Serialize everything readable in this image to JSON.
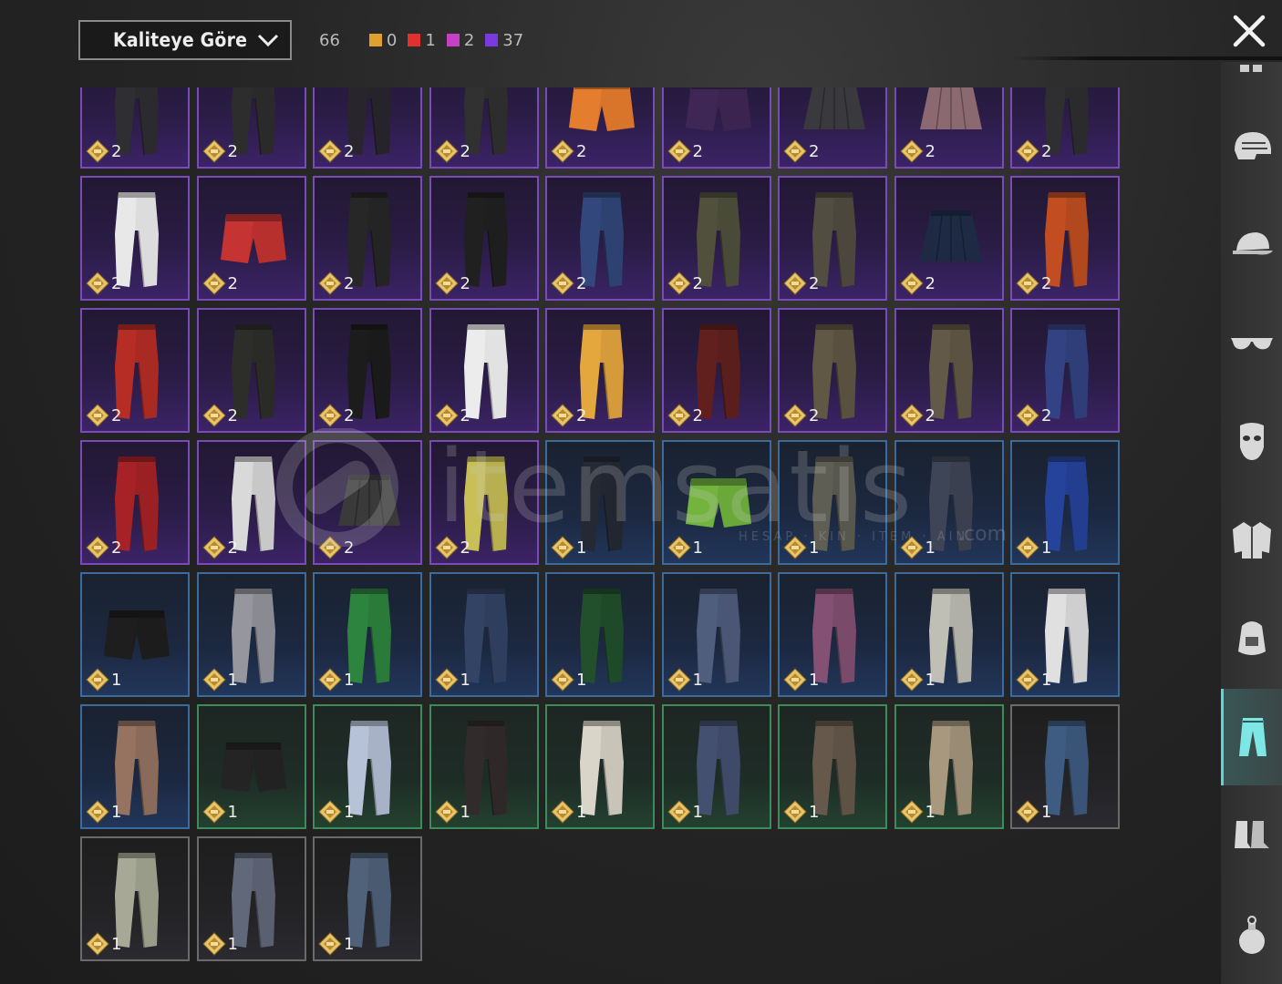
{
  "toolbar": {
    "sort_label": "Kaliteye Göre",
    "total_count": "66",
    "quality_counts": [
      {
        "color": "#e0a030",
        "value": "0"
      },
      {
        "color": "#e03030",
        "value": "1"
      },
      {
        "color": "#c640c6",
        "value": "2"
      },
      {
        "color": "#7a3ae0",
        "value": "37"
      }
    ]
  },
  "watermark": {
    "text": "itemsatis",
    "sub": "HESAP · KIN · ITEM · AIN",
    "com": ".com"
  },
  "items": [
    {
      "rarity": "purple",
      "qty": "2",
      "kind": "pants",
      "color": "#2b2b2f"
    },
    {
      "rarity": "purple",
      "qty": "2",
      "kind": "pants",
      "color": "#2a2a2a"
    },
    {
      "rarity": "purple",
      "qty": "2",
      "kind": "pants",
      "color": "#26232a"
    },
    {
      "rarity": "purple",
      "qty": "2",
      "kind": "pants",
      "color": "#2d2d2d"
    },
    {
      "rarity": "purple",
      "qty": "2",
      "kind": "shorts",
      "color": "#d8752a"
    },
    {
      "rarity": "purple",
      "qty": "2",
      "kind": "shorts",
      "color": "#3b2550"
    },
    {
      "rarity": "purple",
      "qty": "2",
      "kind": "skirt",
      "color": "#3a3a3e"
    },
    {
      "rarity": "purple",
      "qty": "2",
      "kind": "skirt",
      "color": "#8a6a70"
    },
    {
      "rarity": "purple",
      "qty": "2",
      "kind": "pants",
      "color": "#2b2b2e"
    },
    {
      "rarity": "purple",
      "qty": "2",
      "kind": "pants",
      "color": "#dcdcdc"
    },
    {
      "rarity": "purple",
      "qty": "2",
      "kind": "shorts",
      "color": "#b8302e"
    },
    {
      "rarity": "purple",
      "qty": "2",
      "kind": "pants",
      "color": "#242424"
    },
    {
      "rarity": "purple",
      "qty": "2",
      "kind": "pants",
      "color": "#1e1e1e"
    },
    {
      "rarity": "purple",
      "qty": "2",
      "kind": "pants",
      "color": "#2e4272"
    },
    {
      "rarity": "purple",
      "qty": "2",
      "kind": "pants",
      "color": "#4a4a38"
    },
    {
      "rarity": "purple",
      "qty": "2",
      "kind": "pants",
      "color": "#4c473c"
    },
    {
      "rarity": "purple",
      "qty": "2",
      "kind": "skirt",
      "color": "#1e2a44"
    },
    {
      "rarity": "purple",
      "qty": "2",
      "kind": "pants",
      "color": "#b2481e"
    },
    {
      "rarity": "purple",
      "qty": "2",
      "kind": "pants",
      "color": "#a82a22"
    },
    {
      "rarity": "purple",
      "qty": "2",
      "kind": "pants",
      "color": "#2a2a26"
    },
    {
      "rarity": "purple",
      "qty": "2",
      "kind": "pants",
      "color": "#1a1a1a"
    },
    {
      "rarity": "purple",
      "qty": "2",
      "kind": "pants",
      "color": "#e2e2e2"
    },
    {
      "rarity": "purple",
      "qty": "2",
      "kind": "pants",
      "color": "#d59a3a"
    },
    {
      "rarity": "purple",
      "qty": "2",
      "kind": "pants",
      "color": "#5a1e1c"
    },
    {
      "rarity": "purple",
      "qty": "2",
      "kind": "pants",
      "color": "#5a5040"
    },
    {
      "rarity": "purple",
      "qty": "2",
      "kind": "pants",
      "color": "#5b5242"
    },
    {
      "rarity": "purple",
      "qty": "2",
      "kind": "pants",
      "color": "#2f3d78"
    },
    {
      "rarity": "purple",
      "qty": "2",
      "kind": "pants",
      "color": "#9a2024"
    },
    {
      "rarity": "purple",
      "qty": "2",
      "kind": "pants",
      "color": "#c8c8c8"
    },
    {
      "rarity": "purple",
      "qty": "2",
      "kind": "skirt",
      "color": "#3a3a3a"
    },
    {
      "rarity": "purple",
      "qty": "2",
      "kind": "pants",
      "color": "#b8b050"
    },
    {
      "rarity": "blue",
      "qty": "1",
      "kind": "pants",
      "color": "#222630"
    },
    {
      "rarity": "blue",
      "qty": "1",
      "kind": "shorts",
      "color": "#6aa83a"
    },
    {
      "rarity": "blue",
      "qty": "1",
      "kind": "pants",
      "color": "#57574e"
    },
    {
      "rarity": "blue",
      "qty": "1",
      "kind": "pants",
      "color": "#3a4050"
    },
    {
      "rarity": "blue",
      "qty": "1",
      "kind": "pants",
      "color": "#233e8e"
    },
    {
      "rarity": "blue",
      "qty": "1",
      "kind": "shorts",
      "color": "#1c1c1c"
    },
    {
      "rarity": "blue",
      "qty": "1",
      "kind": "pants",
      "color": "#8a8a92"
    },
    {
      "rarity": "blue",
      "qty": "1",
      "kind": "pants",
      "color": "#2a7a3a"
    },
    {
      "rarity": "blue",
      "qty": "1",
      "kind": "pants",
      "color": "#2e3e5c"
    },
    {
      "rarity": "blue",
      "qty": "1",
      "kind": "pants",
      "color": "#1f4a2a"
    },
    {
      "rarity": "blue",
      "qty": "1",
      "kind": "pants",
      "color": "#4a5674"
    },
    {
      "rarity": "blue",
      "qty": "1",
      "kind": "pants",
      "color": "#7a4a6a"
    },
    {
      "rarity": "blue",
      "qty": "1",
      "kind": "pants",
      "color": "#b0b0a8"
    },
    {
      "rarity": "blue",
      "qty": "1",
      "kind": "pants",
      "color": "#cfcfcf"
    },
    {
      "rarity": "blue",
      "qty": "1",
      "kind": "pants",
      "color": "#8a6a5a"
    },
    {
      "rarity": "green",
      "qty": "1",
      "kind": "shorts",
      "color": "#222222"
    },
    {
      "rarity": "green",
      "qty": "1",
      "kind": "pants",
      "color": "#a8b2c6"
    },
    {
      "rarity": "green",
      "qty": "1",
      "kind": "pants",
      "color": "#2e2828"
    },
    {
      "rarity": "green",
      "qty": "1",
      "kind": "pants",
      "color": "#c8c4b8"
    },
    {
      "rarity": "green",
      "qty": "1",
      "kind": "pants",
      "color": "#3e4a68"
    },
    {
      "rarity": "green",
      "qty": "1",
      "kind": "pants",
      "color": "#5e5246"
    },
    {
      "rarity": "green",
      "qty": "1",
      "kind": "pants",
      "color": "#9a8c74"
    },
    {
      "rarity": "gray",
      "qty": "1",
      "kind": "pants",
      "color": "#3a5478"
    },
    {
      "rarity": "gray",
      "qty": "1",
      "kind": "pants",
      "color": "#9a9c8a"
    },
    {
      "rarity": "gray",
      "qty": "1",
      "kind": "pants",
      "color": "#5a6070"
    },
    {
      "rarity": "gray",
      "qty": "1",
      "kind": "pants",
      "color": "#4a5a70"
    }
  ],
  "sidebar": [
    {
      "icon": "helmet-icon",
      "active": false
    },
    {
      "icon": "cap-icon",
      "active": false
    },
    {
      "icon": "glasses-icon",
      "active": false
    },
    {
      "icon": "mask-icon",
      "active": false
    },
    {
      "icon": "jacket-icon",
      "active": false
    },
    {
      "icon": "backpack-icon",
      "active": false
    },
    {
      "icon": "pants-icon",
      "active": true
    },
    {
      "icon": "shoes-icon",
      "active": false
    },
    {
      "icon": "grenade-icon",
      "active": false
    }
  ]
}
